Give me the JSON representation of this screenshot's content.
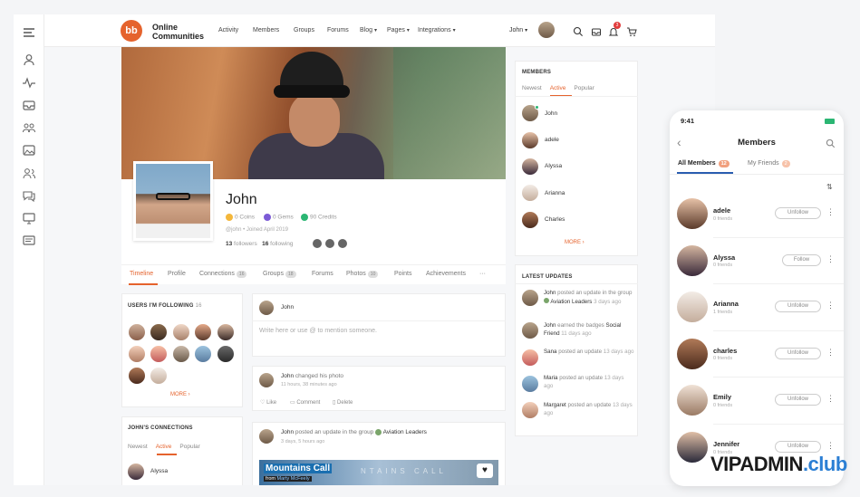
{
  "app": {
    "logo_text": "Online Communities",
    "nav": [
      "Activity",
      "Members",
      "Groups",
      "Forums",
      "Blog",
      "Pages",
      "Integrations"
    ],
    "user_name": "John",
    "notification_count": "3"
  },
  "profile": {
    "name": "John",
    "coins": "0 Coins",
    "gems": "0 Gems",
    "credits": "90 Credits",
    "handle": "@john • Joined April 2019",
    "followers_count": "13",
    "followers_label": "followers",
    "following_count": "16",
    "following_label": "following"
  },
  "tabs": [
    {
      "label": "Timeline"
    },
    {
      "label": "Profile"
    },
    {
      "label": "Connections",
      "count": "16"
    },
    {
      "label": "Groups",
      "count": "18"
    },
    {
      "label": "Forums"
    },
    {
      "label": "Photos",
      "count": "10"
    },
    {
      "label": "Points"
    },
    {
      "label": "Achievements"
    },
    {
      "label": "···"
    }
  ],
  "following_widget": {
    "title": "USERS I'M FOLLOWING",
    "count": "16",
    "more": "MORE"
  },
  "connections_widget": {
    "title": "JOHN'S CONNECTIONS",
    "tabs": [
      "Newest",
      "Active",
      "Popular"
    ],
    "first_member": "Alyssa"
  },
  "composer": {
    "user": "John",
    "placeholder": "Write here or use @ to mention someone."
  },
  "feed": [
    {
      "user": "John",
      "action": "changed his photo",
      "time": "11 hours, 38 minutes ago",
      "actions": [
        "Like",
        "Comment",
        "Delete"
      ]
    },
    {
      "user": "John",
      "action": "posted an update in the group",
      "group": "Aviation Leaders",
      "time": "3 days, 5 hours ago",
      "banner_title": "Mountains Call",
      "banner_from": "from",
      "banner_author": "Marty McFeely",
      "banner_faded": "NTAINS CALL"
    }
  ],
  "members_widget": {
    "title": "MEMBERS",
    "tabs": [
      "Newest",
      "Active",
      "Popular"
    ],
    "items": [
      "John",
      "adele",
      "Alyssa",
      "Arianna",
      "Charles"
    ],
    "more": "MORE"
  },
  "latest_updates": {
    "title": "LATEST UPDATES",
    "items": [
      {
        "user": "John",
        "text": "posted an update in the group",
        "group": "Aviation Leaders",
        "time": "3 days ago"
      },
      {
        "user": "John",
        "text": "earned the badges",
        "badge": "Social Friend",
        "time": "11 days ago"
      },
      {
        "user": "Sana",
        "text": "posted an update",
        "time": "13 days ago"
      },
      {
        "user": "Maria",
        "text": "posted an update",
        "time": "13 days ago"
      },
      {
        "user": "Margaret",
        "text": "posted an update",
        "time": "13 days ago"
      }
    ]
  },
  "phone": {
    "time": "9:41",
    "title": "Members",
    "tabs": [
      {
        "label": "All Members",
        "count": "12"
      },
      {
        "label": "My Friends",
        "count": "2"
      }
    ],
    "members": [
      {
        "name": "adele",
        "sub": "0 friends",
        "button": "Unfollow"
      },
      {
        "name": "Alyssa",
        "sub": "0 friends",
        "button": "Follow"
      },
      {
        "name": "Arianna",
        "sub": "1 friends",
        "button": "Unfollow"
      },
      {
        "name": "charles",
        "sub": "0 friends",
        "button": "Unfollow"
      },
      {
        "name": "Emily",
        "sub": "0 friends",
        "button": "Unfollow"
      },
      {
        "name": "Jennifer",
        "sub": "0 friends",
        "button": "Unfollow"
      }
    ]
  },
  "watermark": {
    "main": "VIPADMIN",
    "suffix": ".club"
  },
  "colors": {
    "accent": "#e5632d",
    "online": "#2bb673",
    "phone_accent": "#2a5db0"
  }
}
